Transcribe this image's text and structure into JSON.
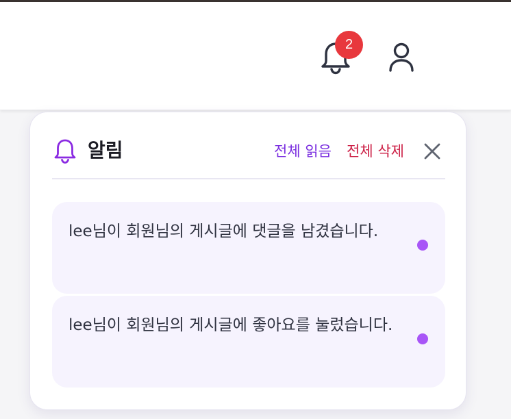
{
  "header": {
    "notification_count": "2",
    "icons": [
      "bell-icon",
      "user-icon"
    ]
  },
  "panel": {
    "title": "알림",
    "read_all_label": "전체 읽음",
    "delete_all_label": "전체 삭제",
    "icons": [
      "bell-icon",
      "close-icon"
    ]
  },
  "notifications": [
    {
      "text": "lee님이 회원님의 게시글에 댓글을 남겼습니다.",
      "unread": true
    },
    {
      "text": "lee님이 회원님의 게시글에 좋아요를 눌렀습니다.",
      "unread": true
    }
  ],
  "colors": {
    "badge": "#e8383d",
    "accent_purple": "#7b2fe0",
    "delete_red": "#cc1f45",
    "unread_dot": "#a855f7",
    "item_bg": "#f6f3fe"
  }
}
